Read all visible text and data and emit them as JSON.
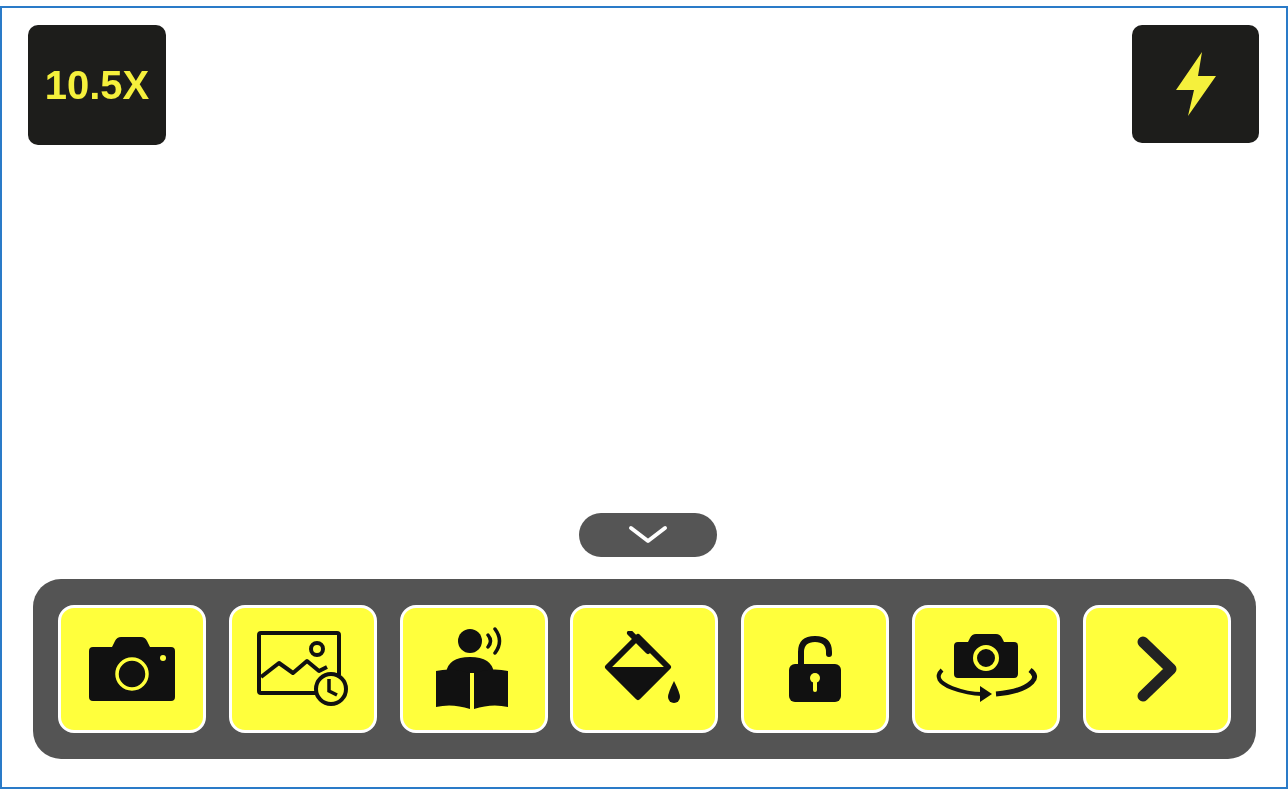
{
  "zoom_button": {
    "label": "10.5X"
  },
  "flash_button": {
    "kind": "flash"
  },
  "collapse_button": {
    "kind": "chevron_down"
  },
  "toolbar": [
    {
      "kind": "camera"
    },
    {
      "kind": "gallery"
    },
    {
      "kind": "reader"
    },
    {
      "kind": "bucket"
    },
    {
      "kind": "lock"
    },
    {
      "kind": "switch"
    },
    {
      "kind": "next"
    }
  ]
}
